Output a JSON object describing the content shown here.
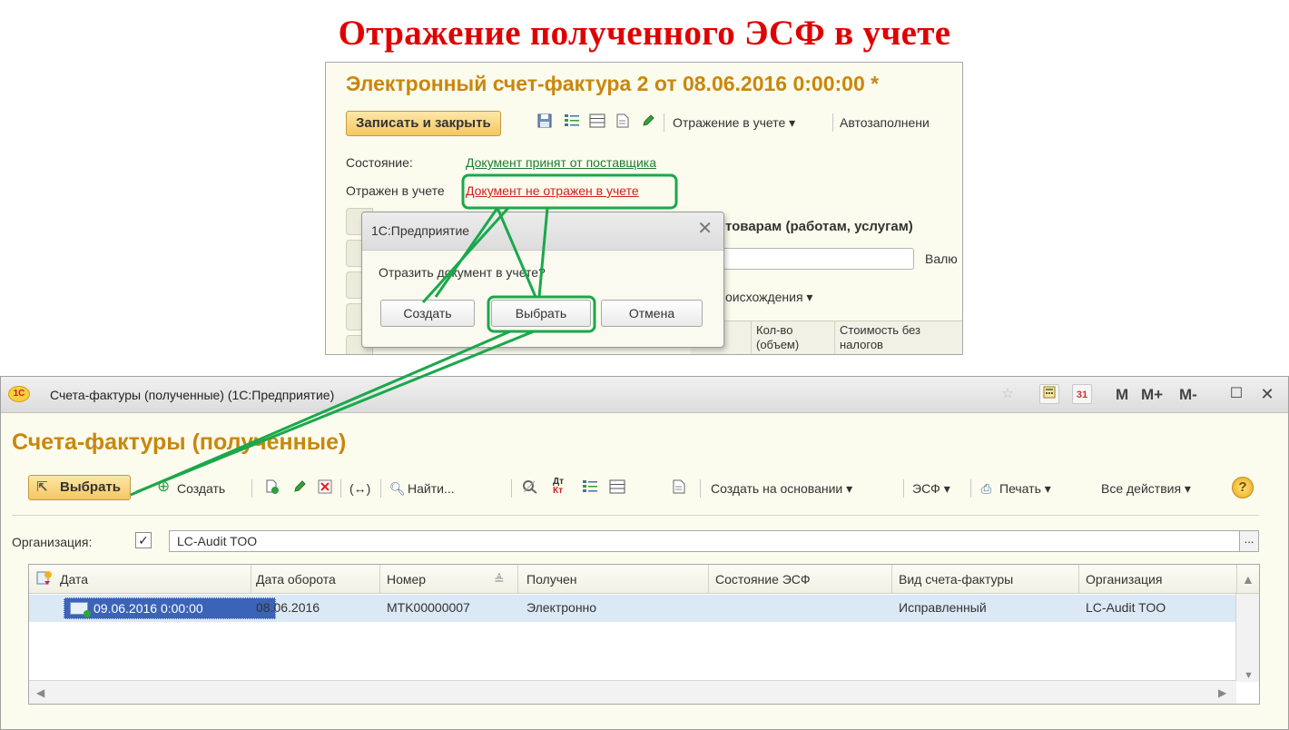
{
  "slide_title": "Отражение полученного ЭСФ в учете",
  "doc": {
    "title": "Электронный счет-фактура 2 от 08.06.2016 0:00:00 *",
    "save_close": "Записать и закрыть",
    "reflect_menu": "Отражение в учете",
    "autofill": "Автозаполнени",
    "state_label": "Состояние:",
    "state_value": "Документ принят от поставщика",
    "reflected_label": "Отражен в учете",
    "reflected_value": "Документ не отражен в учете",
    "section_title": "товарам (работам, услугам)",
    "currency_label": "Валю",
    "origin_label": "оисхождения",
    "col_qty": "Кол-во (объем)",
    "col_cost": "Стоимость без налогов"
  },
  "dialog": {
    "title": "1С:Предприятие",
    "message": "Отразить документ в учете?",
    "create": "Создать",
    "select": "Выбрать",
    "cancel": "Отмена"
  },
  "list": {
    "window_title": "Счета-фактуры (полученные)  (1С:Предприятие)",
    "heading": "Счета-фактуры (полученные)",
    "toolbar": {
      "select": "Выбрать",
      "create": "Создать",
      "find": "Найти...",
      "create_based": "Создать на основании",
      "esf": "ЭСФ",
      "print": "Печать",
      "all_actions": "Все действия"
    },
    "titlebar_m": [
      "M",
      "M+",
      "M-"
    ],
    "org_label": "Организация:",
    "org_value": "LC-Audit TOO",
    "columns": [
      "Дата",
      "Дата оборота",
      "Номер",
      "Получен",
      "Состояние ЭСФ",
      "Вид счета-фактуры",
      "Организация"
    ],
    "rows": [
      {
        "date": "09.06.2016 0:00:00",
        "turnover_date": "08.06.2016",
        "number": "MTK00000007",
        "received": "Электронно",
        "esf_state": "",
        "type": "Исправленный",
        "org": "LC-Audit TOO"
      }
    ]
  },
  "colors": {
    "title_red": "#e00000",
    "heading_gold": "#c9870c",
    "annotation_green": "#1aa84b",
    "selection_blue": "#3b64b8"
  }
}
